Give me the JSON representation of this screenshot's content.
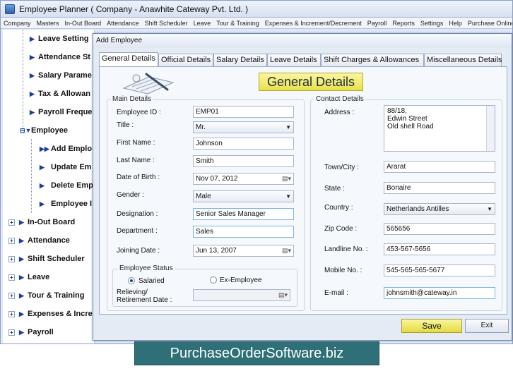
{
  "app": {
    "title": "Employee Planner ( Company - Anawhite Cateway Pvt. Ltd. )"
  },
  "menu": [
    "Company",
    "Masters",
    "In-Out Board",
    "Attendance",
    "Shift Scheduler",
    "Leave",
    "Tour & Training",
    "Expenses & Increment/Decrement",
    "Payroll",
    "Reports",
    "Settings",
    "Help",
    "Purchase Online"
  ],
  "tree": {
    "items_top": [
      "Leave Setting",
      "Attendance St",
      "Salary Parame",
      "Tax & Allowan",
      "Payroll Freque"
    ],
    "employee": "Employee",
    "employee_children": [
      "Add Emplo",
      "Update Em",
      "Delete Emp",
      "Employee I"
    ],
    "groups": [
      "In-Out Board",
      "Attendance",
      "Shift Scheduler",
      "Leave",
      "Tour & Training",
      "Expenses & Incre",
      "Payroll"
    ]
  },
  "dialog": {
    "title": "Add Employee",
    "tabs": [
      "General Details",
      "Official Details",
      "Salary Details",
      "Leave Details",
      "Shift Charges & Allowances",
      "Miscellaneous Details"
    ],
    "heading": "General Details",
    "main_details": {
      "legend": "Main Details",
      "employee_id_label": "Employee ID :",
      "employee_id": "EMP01",
      "title_label": "Title :",
      "title_value": "Mr.",
      "first_name_label": "First Name :",
      "first_name": "Johnson",
      "last_name_label": "Last Name :",
      "last_name": "Smith",
      "dob_label": "Date of Birth :",
      "dob": "Nov 07, 2012",
      "gender_label": "Gender :",
      "gender": "Male",
      "designation_label": "Designation :",
      "designation": "Senior Sales Manager",
      "department_label": "Department :",
      "department": "Sales",
      "joining_label": "Joining Date :",
      "joining": "Jun 13, 2007"
    },
    "employee_status": {
      "legend": "Employee Status",
      "salaried": "Salaried",
      "ex_employee": "Ex-Employee",
      "relieving_label_1": "Relieving/",
      "relieving_label_2": "Retirement Date :"
    },
    "contact_details": {
      "legend": "Contact Details",
      "address_label": "Address :",
      "address_lines": [
        "88/18,",
        "Edwin Street",
        "Old shell Road"
      ],
      "town_label": "Town/City :",
      "town": "Ararat",
      "state_label": "State :",
      "state": "Bonaire",
      "country_label": "Country :",
      "country": "Netherlands Antilles",
      "zip_label": "Zip Code :",
      "zip": "565656",
      "landline_label": "Landline No. :",
      "landline": "453-567-5656",
      "mobile_label": "Mobile No. :",
      "mobile": "545-565-565-5677",
      "email_label": "E-mail :",
      "email": "johnsmith@cateway.in"
    },
    "save_label": "Save",
    "exit_label": "Exit"
  },
  "footer": "PurchaseOrderSoftware.biz",
  "colors": {
    "heading_bg": "#f2ec72",
    "footer_bg": "#2f6f77",
    "tree_arrow": "#1a3f9a"
  }
}
